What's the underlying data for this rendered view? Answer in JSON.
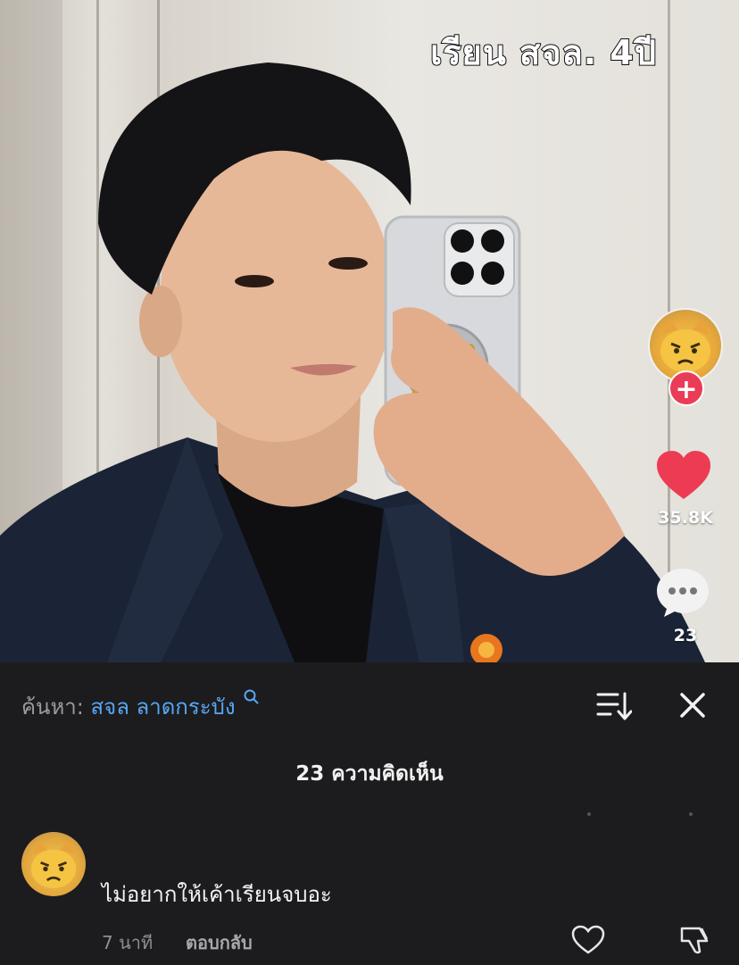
{
  "video": {
    "overlay_text": "เรียน สจล. 4ปี",
    "like_count": "35.8K",
    "comment_count": "23",
    "icons": [
      "follow-plus-icon",
      "heart-icon",
      "comment-bubble-icon"
    ]
  },
  "sheet": {
    "search_prefix": "ค้นหา:",
    "search_term": "สจล ลาดกระบัง",
    "title": "23 ความคิดเห็น",
    "icons": [
      "search-icon",
      "sort-icon",
      "close-icon"
    ]
  },
  "comments": [
    {
      "text": "ไม่อยากให้เค้าเรียนจบอะ",
      "time": "7 นาที",
      "reply_label": "ตอบกลับ"
    }
  ],
  "colors": {
    "accent_red": "#ea3b57",
    "link_blue": "#58a6f4",
    "sheet_bg": "#1c1c1e"
  }
}
